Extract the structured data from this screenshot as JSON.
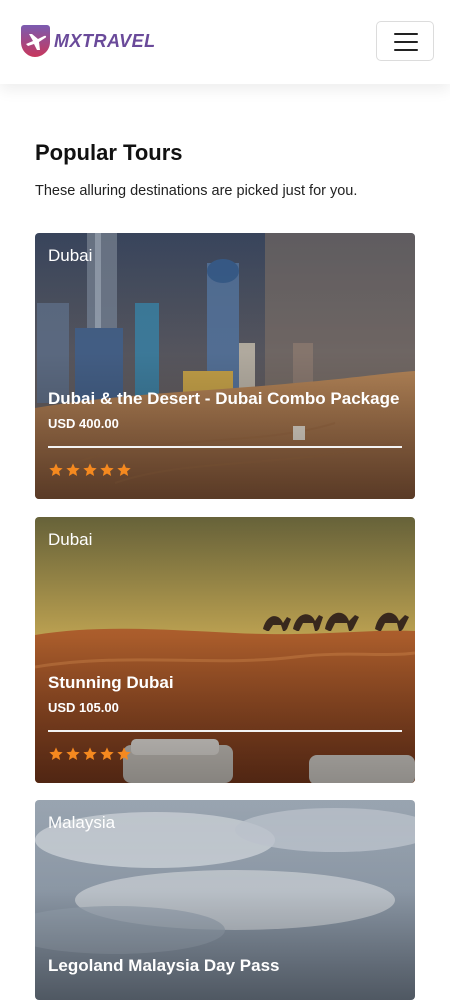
{
  "brand": {
    "name": "MXTRAVEL",
    "color": "#6a4a9a"
  },
  "icons": {
    "menu": "hamburger-menu-icon",
    "star": "star-icon",
    "logo": "plane-logo-icon"
  },
  "section": {
    "title": "Popular Tours",
    "subtitle": "These alluring destinations are picked just for you."
  },
  "tours": [
    {
      "location": "Dubai",
      "name": "Dubai & the Desert - Dubai Combo Package",
      "price": "USD 400.00",
      "rating": 5
    },
    {
      "location": "Dubai",
      "name": "Stunning Dubai",
      "price": "USD 105.00",
      "rating": 5
    },
    {
      "location": "Malaysia",
      "name": "Legoland Malaysia Day Pass"
    }
  ],
  "colors": {
    "star": "#f5891f",
    "divider": "#f3f3f3"
  }
}
